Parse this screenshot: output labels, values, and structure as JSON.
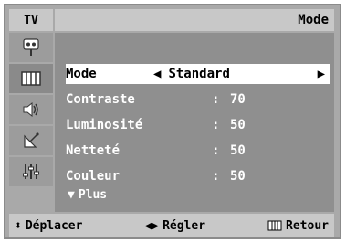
{
  "top_label": "TV",
  "header_title": "Mode",
  "menu": {
    "selected_label": "Mode",
    "selected_value": "Standard",
    "rows": [
      {
        "label": "Contraste",
        "sep": ":",
        "value": "70"
      },
      {
        "label": "Luminosité",
        "sep": ":",
        "value": "50"
      },
      {
        "label": "Netteté",
        "sep": ":",
        "value": "50"
      },
      {
        "label": "Couleur",
        "sep": ":",
        "value": "50"
      }
    ],
    "more_label": "Plus"
  },
  "footer": {
    "move_label": "Déplacer",
    "adjust_label": "Régler",
    "return_label": "Retour"
  },
  "icons": [
    "antenna-icon",
    "picture-icon",
    "speaker-icon",
    "satellite-dish-icon",
    "equalizer-icon"
  ],
  "colors": {
    "panel": "#8f8f8f",
    "header": "#c8c8c8",
    "selected_row": "#ffffff"
  }
}
